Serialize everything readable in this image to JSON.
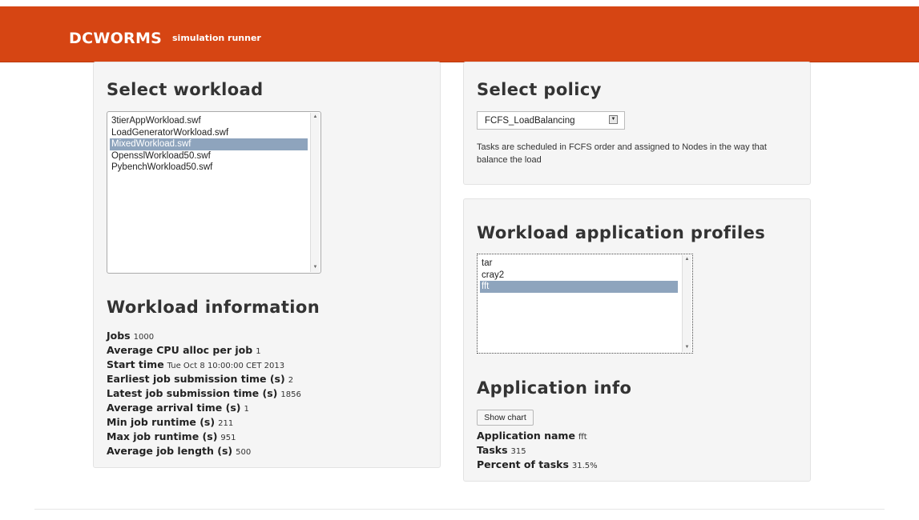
{
  "header": {
    "brand": "DCWORMS",
    "tagline": "simulation runner"
  },
  "workload": {
    "title": "Select workload",
    "items": [
      "3tierAppWorkload.swf",
      "LoadGeneratorWorkload.swf",
      "MixedWorkload.swf",
      "OpensslWorkload50.swf",
      "PybenchWorkload50.swf"
    ],
    "selected": "MixedWorkload.swf"
  },
  "workload_info": {
    "title": "Workload information",
    "rows": [
      {
        "label": "Jobs",
        "value": "1000"
      },
      {
        "label": "Average CPU alloc per job",
        "value": "1"
      },
      {
        "label": "Start time",
        "value": "Tue Oct 8 10:00:00 CET 2013"
      },
      {
        "label": "Earliest job submission time (s)",
        "value": "2"
      },
      {
        "label": "Latest job submission time (s)",
        "value": "1856"
      },
      {
        "label": "Average arrival time (s)",
        "value": "1"
      },
      {
        "label": "Min job runtime (s)",
        "value": "211"
      },
      {
        "label": "Max job runtime (s)",
        "value": "951"
      },
      {
        "label": "Average job length (s)",
        "value": "500"
      }
    ]
  },
  "policy": {
    "title": "Select policy",
    "selected": "FCFS_LoadBalancing",
    "description_line1": "Tasks are scheduled in FCFS order and assigned to Nodes in the way that",
    "description_line2": "balance the load"
  },
  "profiles": {
    "title": "Workload application profiles",
    "items": [
      "tar",
      "cray2",
      "fft"
    ],
    "selected": "fft"
  },
  "app_info": {
    "title": "Application info",
    "show_chart_label": "Show chart",
    "rows": [
      {
        "label": "Application name",
        "value": "fft"
      },
      {
        "label": "Tasks",
        "value": "315"
      },
      {
        "label": "Percent of tasks",
        "value": "31.5%"
      }
    ]
  },
  "colors": {
    "navbar": "#d64513",
    "selection": "#8ea4bd",
    "panel": "#f5f5f5"
  }
}
